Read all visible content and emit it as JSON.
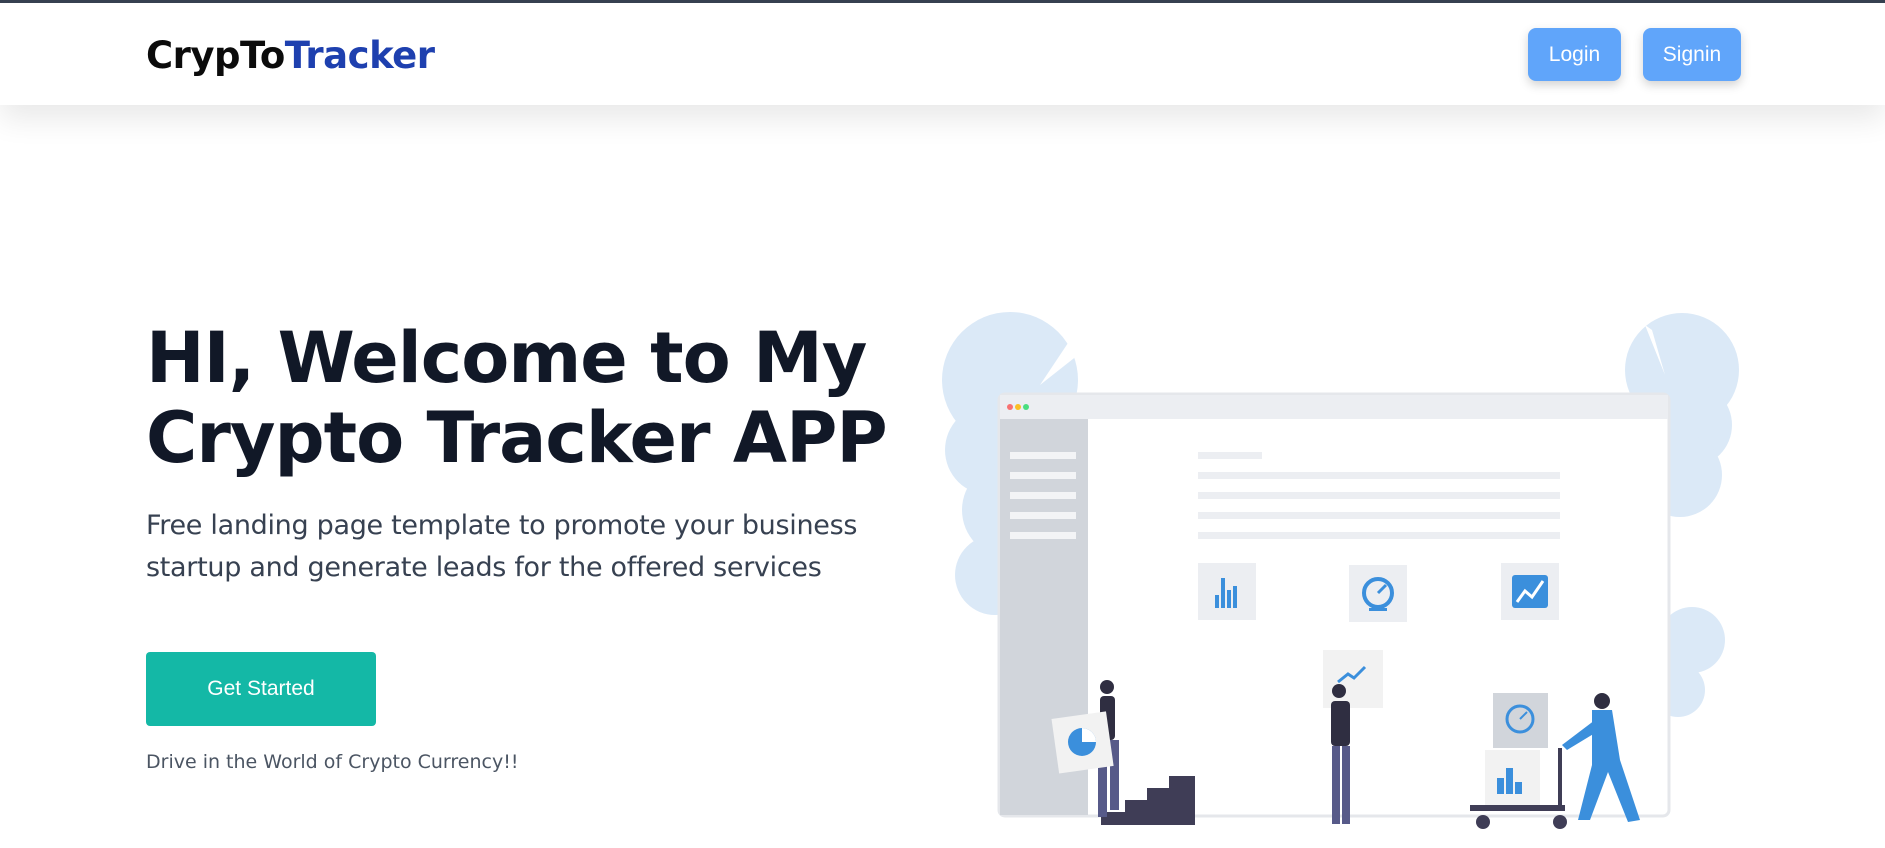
{
  "header": {
    "logo_part1": "CrypTo",
    "logo_part2": "Tracker",
    "login_label": "Login",
    "signin_label": "Signin"
  },
  "hero": {
    "title_line1": "HI, Welcome to My",
    "title_line2": "Crypto Tracker APP",
    "subtitle_line1": "Free landing page template to promote your business",
    "subtitle_line2": "startup and generate leads for the offered services",
    "cta_label": "Get Started",
    "tagline": "Drive in the World of Crypto Currency!!"
  },
  "colors": {
    "brand_accent": "#1e40af",
    "nav_button": "#60a5fa",
    "cta_button": "#14b8a6",
    "illustration_accent": "#3b8fdc"
  },
  "illustration": {
    "icons": [
      "bar-chart-icon",
      "gauge-icon",
      "line-chart-icon",
      "pie-chart-icon",
      "trend-up-icon"
    ]
  }
}
